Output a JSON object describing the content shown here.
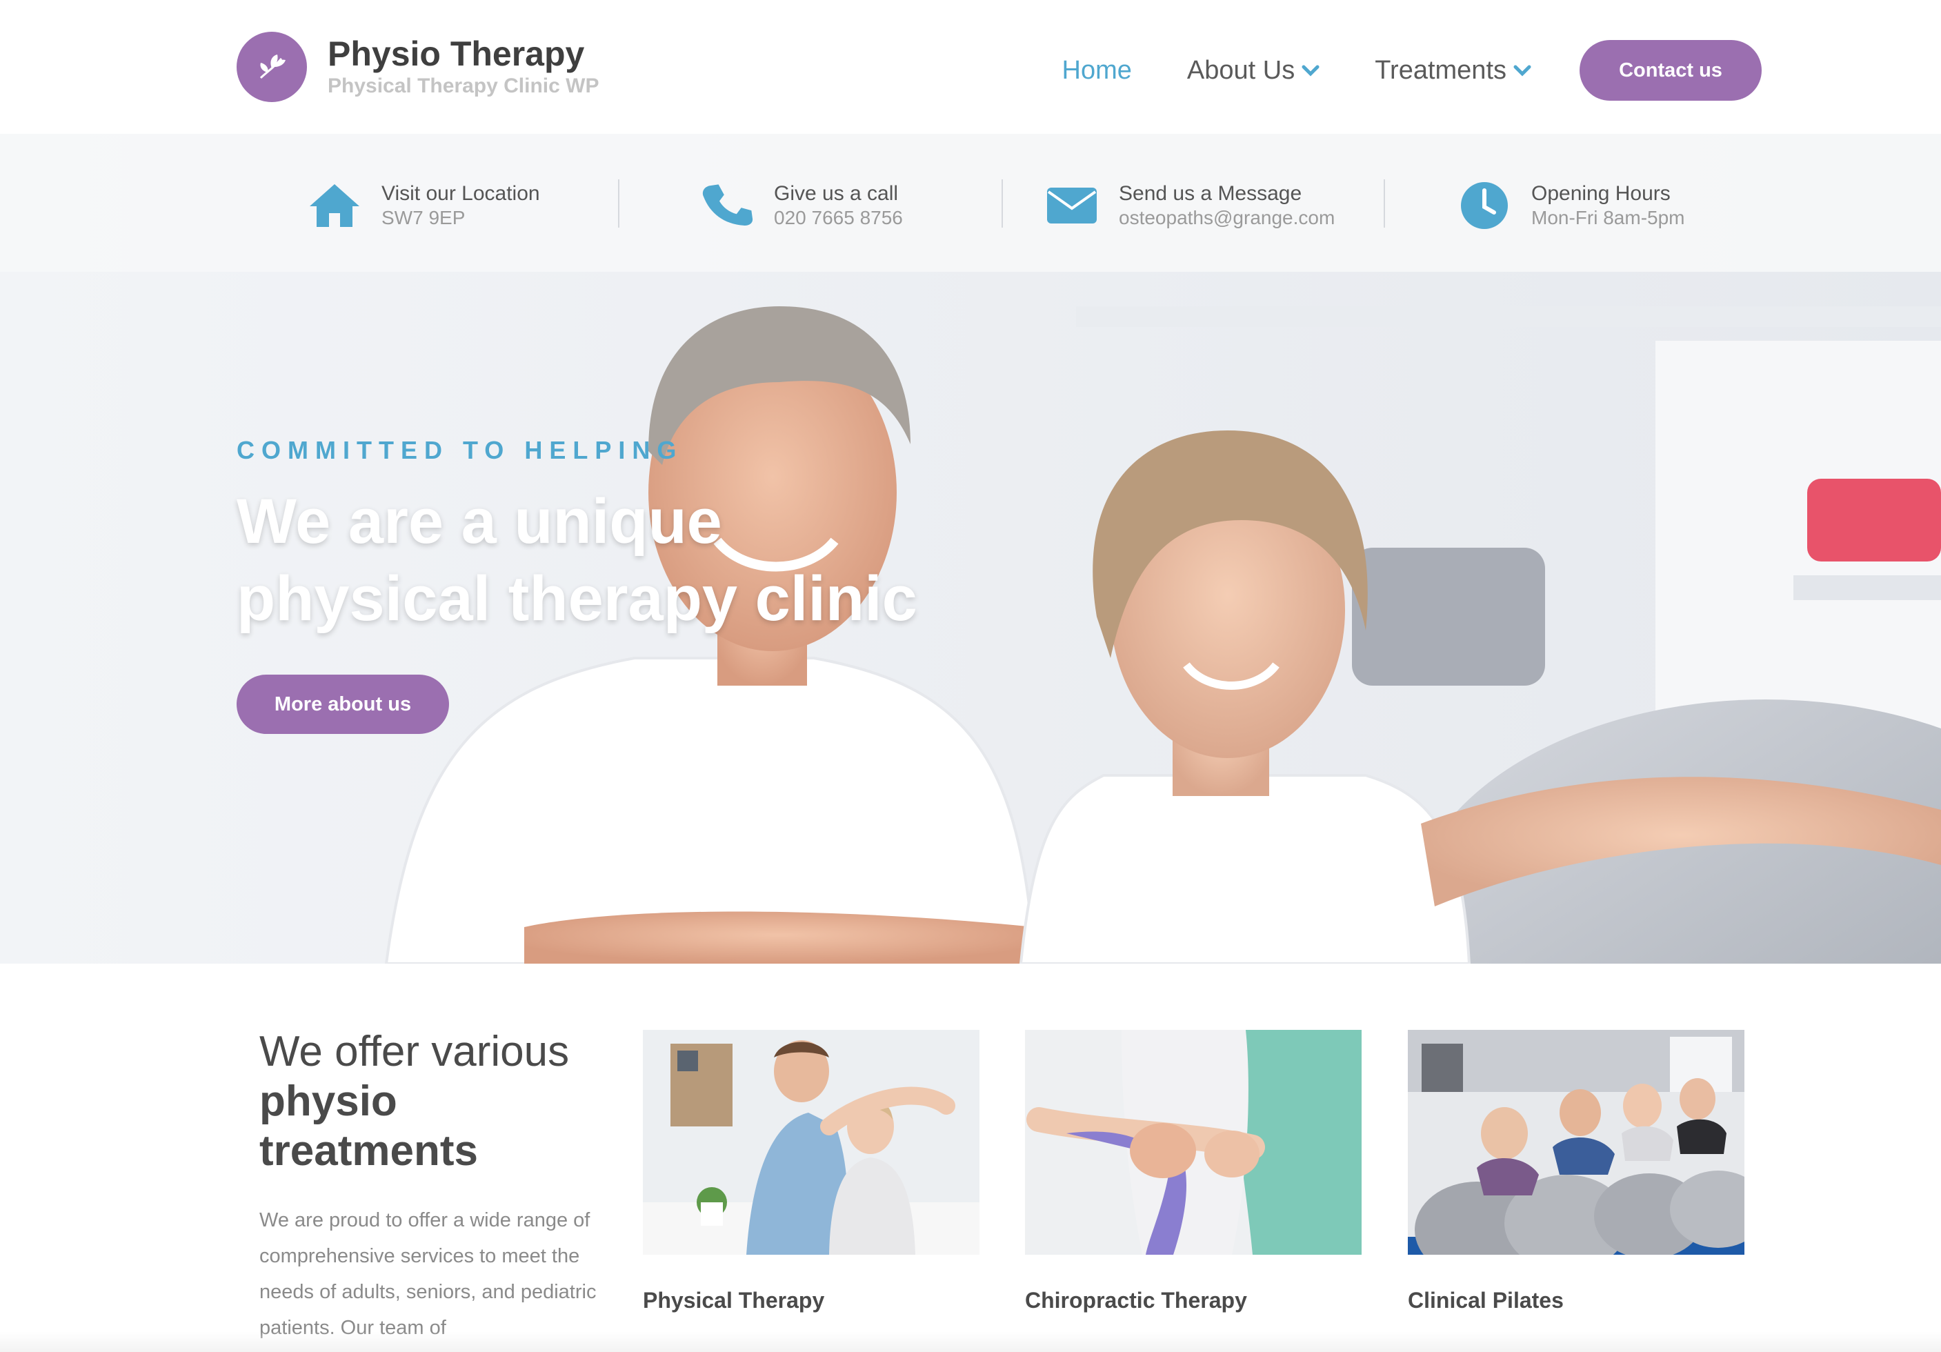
{
  "brand": {
    "title": "Physio Therapy",
    "subtitle": "Physical Therapy Clinic WP",
    "color": "#9b6fb0"
  },
  "nav": {
    "items": [
      {
        "label": "Home",
        "active": true
      },
      {
        "label": "About Us",
        "dropdown": true
      },
      {
        "label": "Treatments",
        "dropdown": true
      }
    ],
    "contact_label": "Contact us"
  },
  "info": [
    {
      "title": "Visit our Location",
      "value": "SW7 9EP",
      "icon": "home-icon"
    },
    {
      "title": "Give us a call",
      "value": "020 7665 8756",
      "icon": "phone-icon"
    },
    {
      "title": "Send us a Message",
      "value": "osteopaths@grange.com",
      "icon": "envelope-icon"
    },
    {
      "title": "Opening Hours",
      "value": "Mon-Fri 8am-5pm",
      "icon": "clock-icon"
    }
  ],
  "hero": {
    "eyebrow": "COMMITTED TO HELPING",
    "title_line1": "We are a unique",
    "title_line2": "physical therapy clinic",
    "button": "More about us"
  },
  "treatments": {
    "heading_light": "We offer various",
    "heading_bold1": "physio",
    "heading_bold2": "treatments",
    "body": "We are proud to offer a wide range of comprehensive services to meet the needs of adults, seniors, and pediatric patients. Our team of",
    "cards": [
      {
        "title": "Physical Therapy"
      },
      {
        "title": "Chiropractic Therapy"
      },
      {
        "title": "Clinical Pilates"
      }
    ]
  },
  "colors": {
    "accent_blue": "#4fa7cf",
    "accent_purple": "#9b6fb0"
  }
}
